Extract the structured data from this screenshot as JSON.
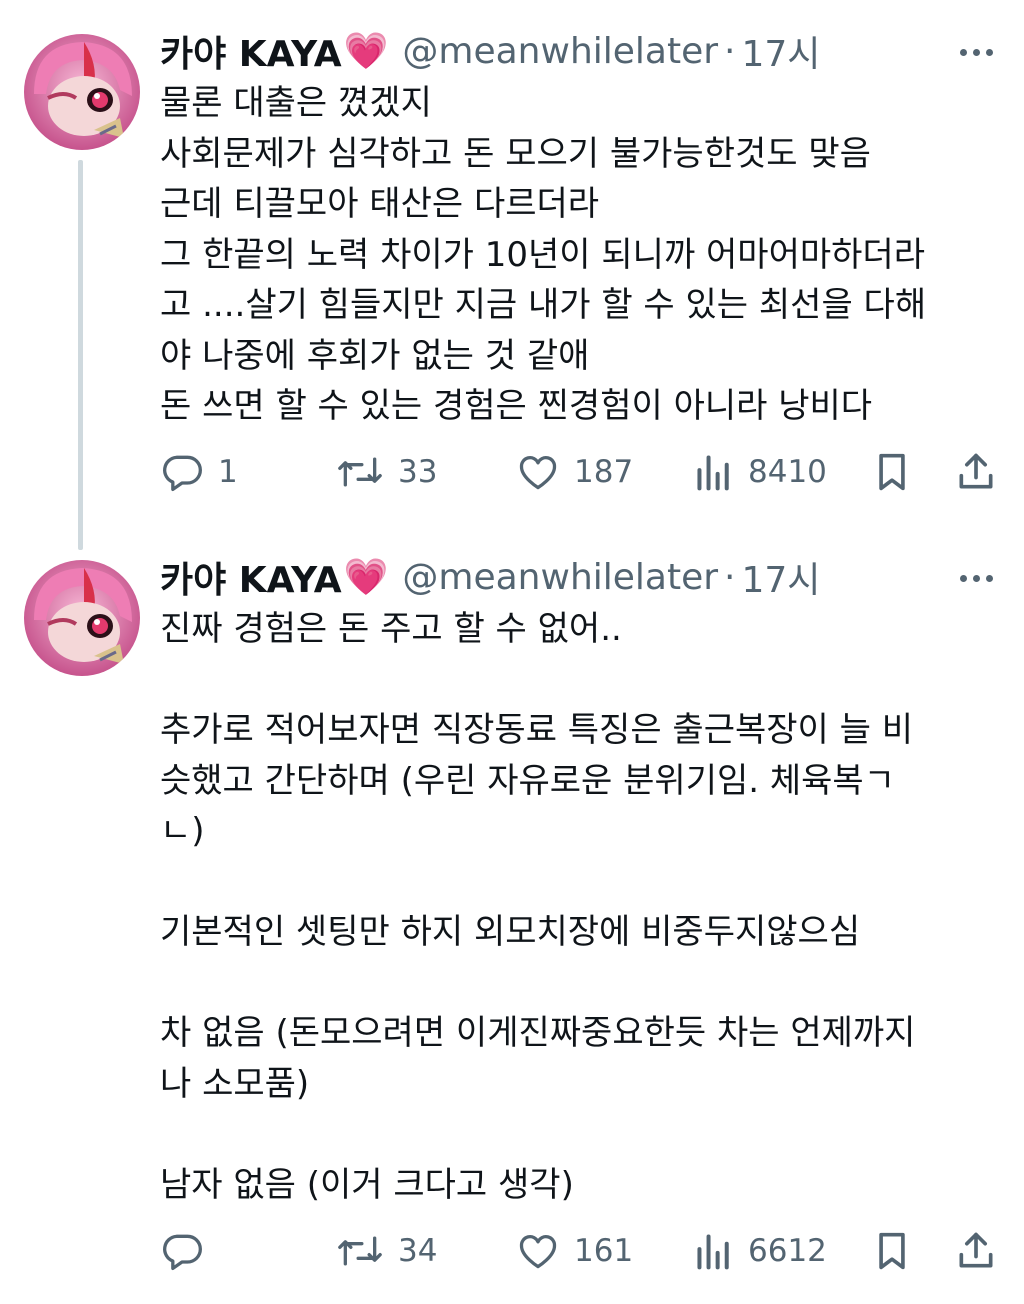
{
  "tweets": [
    {
      "author_name": "카야 KAYA",
      "author_emoji": "💗",
      "handle": "@meanwhilelater",
      "separator": "·",
      "time": "17시",
      "body": "물론 대출은 꼈겠지\n사회문제가 심각하고 돈 모으기 불가능한것도 맞음\n근데 티끌모아 태산은 다르더라\n그 한끝의 노력 차이가 10년이 되니까 어마어마하더라\n고 ....살기 힘들지만 지금 내가 할 수 있는 최선을 다해\n야 나중에 후회가 없는 것 같애\n돈 쓰면 할 수 있는 경험은 찐경험이 아니라 낭비다",
      "replies": "1",
      "retweets": "33",
      "likes": "187",
      "views": "8410"
    },
    {
      "author_name": "카야 KAYA",
      "author_emoji": "💗",
      "handle": "@meanwhilelater",
      "separator": "·",
      "time": "17시",
      "body": "진짜 경험은 돈 주고 할 수 없어..\n\n추가로 적어보자면 직장동료 특징은 출근복장이 늘 비\n슷했고 간단하며 (우린 자유로운 분위기임. 체육복ㄱ\nㄴ)\n\n기본적인 셋팅만 하지 외모치장에 비중두지않으심\n\n차 없음 (돈모으려면 이게진짜중요한듯 차는 언제까지\n나 소모품)\n\n남자 없음 (이거 크다고 생각)",
      "replies": "",
      "retweets": "34",
      "likes": "161",
      "views": "6612"
    }
  ],
  "icons": {
    "reply": "reply-icon",
    "retweet": "retweet-icon",
    "like": "heart-icon",
    "views": "views-icon",
    "bookmark": "bookmark-icon",
    "share": "share-icon",
    "more": "more-icon"
  },
  "colors": {
    "text": "#0f1419",
    "secondary": "#536471",
    "thread_line": "#cfd9de",
    "avatar_pink": "#e86aa5"
  }
}
